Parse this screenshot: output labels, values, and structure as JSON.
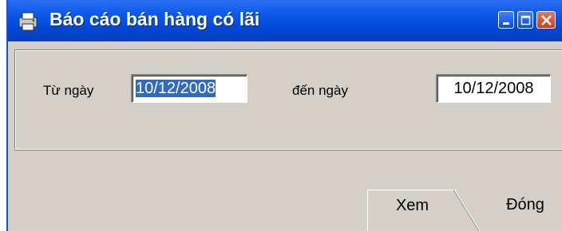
{
  "window": {
    "title": "Báo cáo bán hàng có lãi",
    "icons": {
      "app": "printer-icon",
      "minimize": "minimize-icon",
      "maximize": "maximize-icon",
      "close": "close-icon"
    }
  },
  "form": {
    "from_label": "Từ ngày",
    "from_value": "10/12/2008",
    "to_label": "đến ngày",
    "to_value": "10/12/2008"
  },
  "buttons": {
    "view_label": "Xem",
    "close_label": "Đóng"
  },
  "colors": {
    "titlebar": "#0a58ea",
    "face": "#d4d0c8",
    "selection": "#316ac5",
    "close_button": "#c8401c"
  }
}
